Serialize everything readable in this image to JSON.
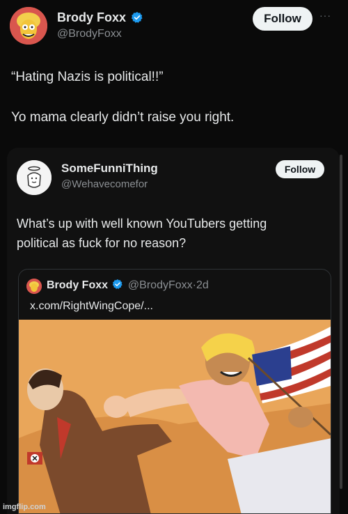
{
  "post": {
    "author_name": "Brody Foxx",
    "author_handle": "@BrodyFoxx",
    "follow_label": "Follow",
    "more_label": "···",
    "line1": "“Hating Nazis is political!!”",
    "line2": "Yo mama clearly didn’t raise you right."
  },
  "quote": {
    "author_name": "SomeFunniThing",
    "author_handle": "@Wehavecomefor",
    "follow_label": "Follow",
    "line1": "What’s up with well known YouTubers getting",
    "line2": "political as fuck for no reason?"
  },
  "nested_quote": {
    "author_name": "Brody Foxx",
    "author_handle": "@BrodyFoxx",
    "time_sep": "·",
    "time": "2d",
    "link_text": "x.com/RightWingCope/..."
  },
  "watermark": "imgflip.com",
  "colors": {
    "verified": "#1d9bf0",
    "follow_bg": "#eff3f4",
    "background": "#0a0a0a"
  }
}
